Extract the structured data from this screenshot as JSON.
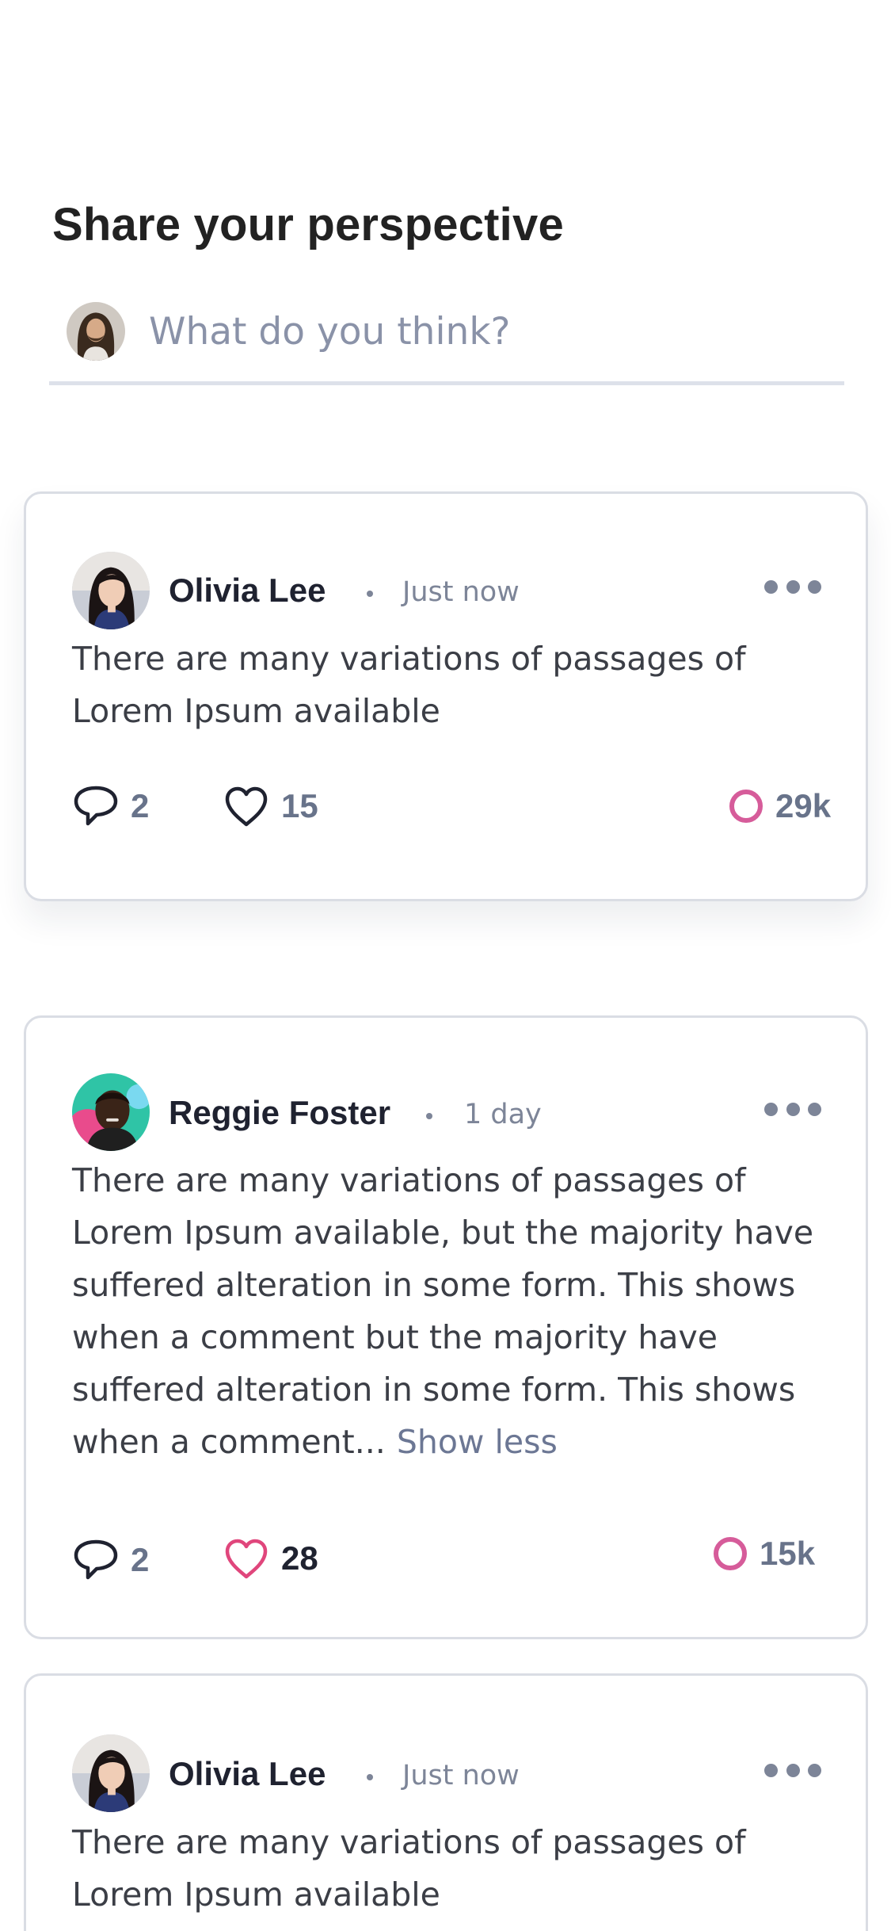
{
  "compose": {
    "title": "Share your perspective",
    "placeholder": "What do you think?"
  },
  "posts": [
    {
      "author": "Olivia Lee",
      "time": "Just now",
      "text": "There are many variations of passages of Lorem Ipsum available",
      "comments": "2",
      "likes": "15",
      "liked": false,
      "views": "29k"
    },
    {
      "author": "Reggie Foster",
      "time": "1 day",
      "text": "There are many variations of passages of Lorem Ipsum available, but the majority have suffered alteration in some form. This shows when a comment but the majority have suffered alteration in some form. This shows when a comment...",
      "show_less": "Show less",
      "comments": "2",
      "likes": "28",
      "liked": true,
      "views": "15k"
    },
    {
      "author": "Olivia Lee",
      "time": "Just now",
      "text": "There are many variations of passages of Lorem Ipsum available"
    }
  ],
  "colors": {
    "accent_pink": "#e0467c",
    "views_ring": "#d65c9a",
    "muted_text": "#7d8598",
    "border": "#dadde4"
  },
  "icons": {
    "comment": "comment-bubble-icon",
    "like": "heart-icon",
    "views": "ring-icon",
    "more": "ellipsis-icon"
  }
}
